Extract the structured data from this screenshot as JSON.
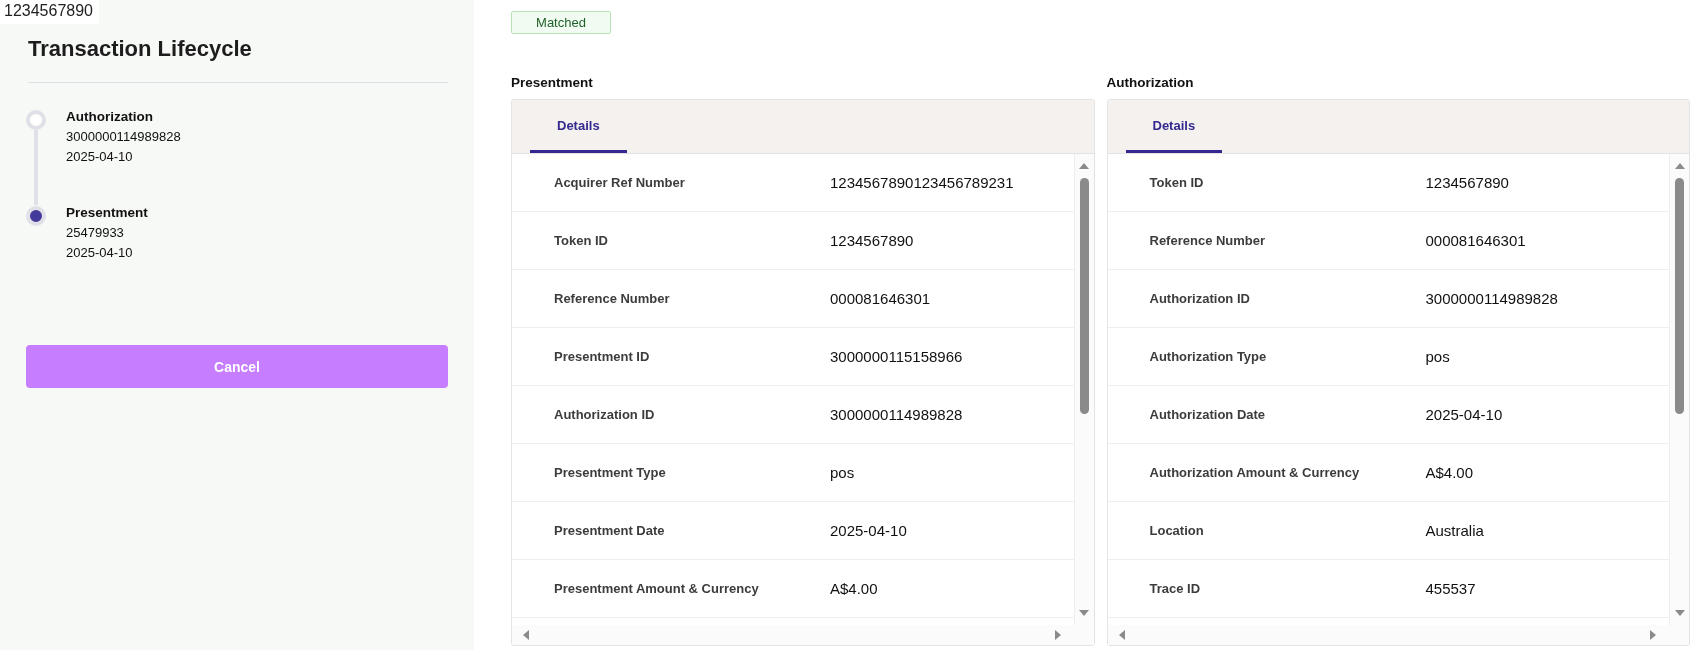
{
  "tooltip": "1234567890",
  "sidebar": {
    "title": "Transaction Lifecycle",
    "timeline": [
      {
        "label": "Authorization",
        "id": "3000000114989828",
        "date": "2025-04-10",
        "selected": false
      },
      {
        "label": "Presentment",
        "id": "25479933",
        "date": "2025-04-10",
        "selected": true
      }
    ],
    "cancel_button": "Cancel"
  },
  "status_badge": "Matched",
  "panels": [
    {
      "heading": "Presentment",
      "tabs": [
        {
          "label": "Details",
          "selected": true
        }
      ],
      "rows": [
        {
          "label": "Acquirer Ref Number",
          "value": "1234567890123456789231"
        },
        {
          "label": "Token ID",
          "value": "1234567890"
        },
        {
          "label": "Reference Number",
          "value": "000081646301"
        },
        {
          "label": "Presentment ID",
          "value": "3000000115158966"
        },
        {
          "label": "Authorization ID",
          "value": "3000000114989828"
        },
        {
          "label": "Presentment Type",
          "value": "pos"
        },
        {
          "label": "Presentment Date",
          "value": "2025-04-10"
        },
        {
          "label": "Presentment Amount & Currency",
          "value": "A$4.00"
        }
      ]
    },
    {
      "heading": "Authorization",
      "tabs": [
        {
          "label": "Details",
          "selected": true
        }
      ],
      "rows": [
        {
          "label": "Token ID",
          "value": "1234567890"
        },
        {
          "label": "Reference Number",
          "value": "000081646301"
        },
        {
          "label": "Authorization ID",
          "value": "3000000114989828"
        },
        {
          "label": "Authorization Type",
          "value": "pos"
        },
        {
          "label": "Authorization Date",
          "value": "2025-04-10"
        },
        {
          "label": "Authorization Amount & Currency",
          "value": "A$4.00"
        },
        {
          "label": "Location",
          "value": "Australia"
        },
        {
          "label": "Trace ID",
          "value": "455537"
        }
      ]
    }
  ]
}
